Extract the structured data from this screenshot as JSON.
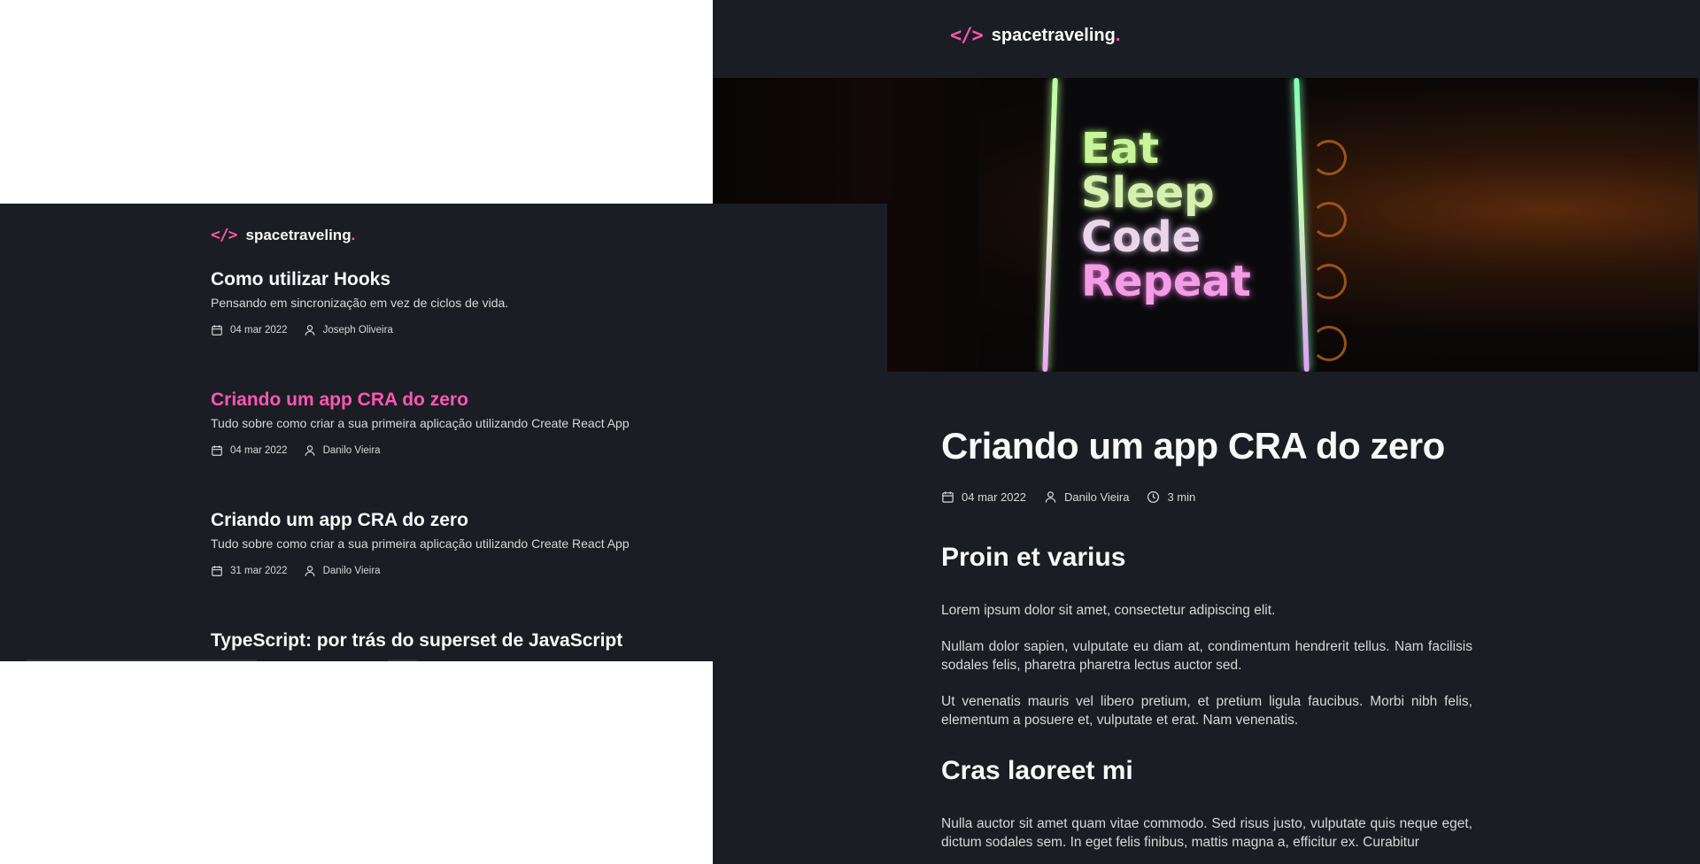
{
  "brand": {
    "icon": "</>",
    "name": "spacetraveling",
    "dot": "."
  },
  "post": {
    "title": "Criando um app CRA do zero",
    "date": "04 mar 2022",
    "author": "Danilo Vieira",
    "reading_time": "3 min",
    "banner": {
      "lines": [
        "Eat",
        "Sleep",
        "Code",
        "Repeat"
      ]
    },
    "sections": [
      {
        "heading": "Proin et varius",
        "paragraphs": [
          "Lorem ipsum dolor sit amet, consectetur adipiscing elit.",
          "Nullam dolor sapien, vulputate eu diam at, condimentum hendrerit tellus. Nam facilisis sodales felis, pharetra pharetra lectus auctor sed.",
          "Ut venenatis mauris vel libero pretium, et pretium ligula faucibus. Morbi nibh felis, elementum a posuere et, vulputate et erat. Nam venenatis."
        ]
      },
      {
        "heading": "Cras laoreet mi",
        "paragraphs": [
          "Nulla auctor sit amet quam vitae commodo. Sed risus justo, vulputate quis neque eget, dictum sodales sem. In eget felis finibus, mattis magna a, efficitur ex. Curabitur"
        ]
      }
    ]
  },
  "home": {
    "posts": [
      {
        "title": "Como utilizar Hooks",
        "subtitle": "Pensando em sincronização em vez de ciclos de vida.",
        "date": "04 mar 2022",
        "author": "Joseph Oliveira"
      },
      {
        "title": "Criando um app CRA do zero",
        "subtitle": "Tudo sobre como criar a sua primeira aplicação utilizando Create React App",
        "date": "04 mar 2022",
        "author": "Danilo Vieira"
      },
      {
        "title": "Criando um app CRA do zero",
        "subtitle": "Tudo sobre como criar a sua primeira aplicação utilizando Create React App",
        "date": "31 mar 2022",
        "author": "Danilo Vieira"
      },
      {
        "title": "TypeScript: por trás do superset de JavaScript"
      }
    ]
  },
  "colors": {
    "background": "#1a1d23",
    "accent": "#ff57b2",
    "heading": "#f8f8f8",
    "text": "#d7d7d7"
  },
  "icons": {
    "logo": "code-brackets-icon",
    "date": "calendar-icon",
    "author": "user-icon",
    "reading_time": "clock-icon"
  }
}
